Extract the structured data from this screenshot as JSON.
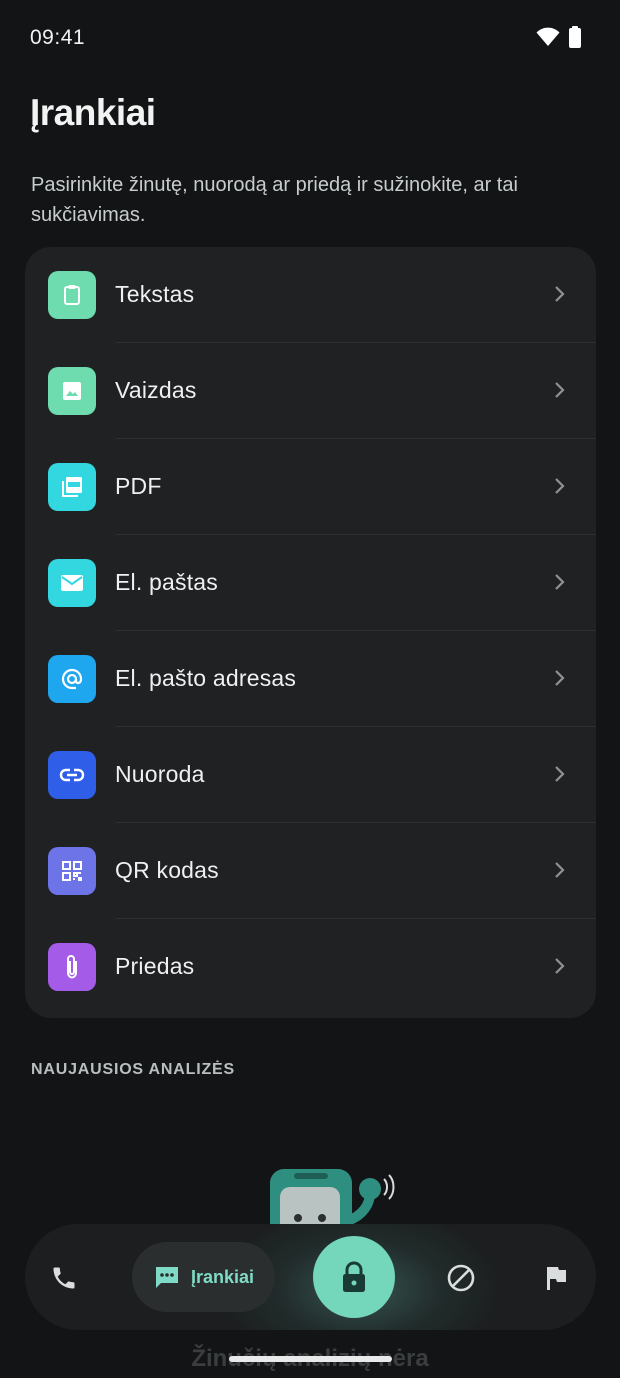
{
  "status": {
    "time": "09:41"
  },
  "page": {
    "title": "Įrankiai",
    "subtitle": "Pasirinkite žinutę, nuorodą ar priedą ir sužinokite, ar tai sukčiavimas."
  },
  "tools": [
    {
      "label": "Tekstas",
      "icon": "clipboard-icon",
      "color": "#6fdcb0"
    },
    {
      "label": "Vaizdas",
      "icon": "image-icon",
      "color": "#6fdcb0"
    },
    {
      "label": "PDF",
      "icon": "pdf-icon",
      "color": "#33d7e0"
    },
    {
      "label": "El. paštas",
      "icon": "mail-icon",
      "color": "#33d7e0"
    },
    {
      "label": "El. pašto adresas",
      "icon": "at-icon",
      "color": "#1ea7ee"
    },
    {
      "label": "Nuoroda",
      "icon": "link-icon",
      "color": "#2f5fe8"
    },
    {
      "label": "QR kodas",
      "icon": "qr-code-icon",
      "color": "#6c74e8"
    },
    {
      "label": "Priedas",
      "icon": "paperclip-icon",
      "color": "#a35be8"
    }
  ],
  "recent": {
    "heading": "NAUJAUSIOS ANALIZĖS",
    "empty_text": "Žinučių analizių nėra"
  },
  "nav": {
    "tools_label": "Įrankiai",
    "accent": "#74d6bb"
  }
}
